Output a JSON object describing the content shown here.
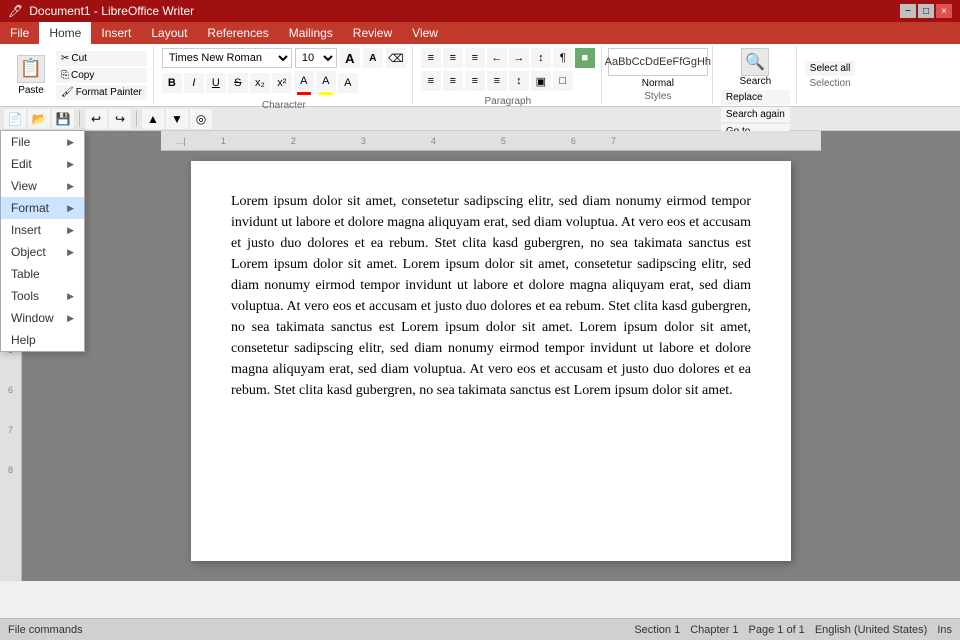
{
  "titleBar": {
    "appName": "Writer",
    "docName": "Document1 - LibreOffice Writer",
    "controls": [
      "−",
      "□",
      "×"
    ]
  },
  "menuBar": {
    "items": [
      "File",
      "Home",
      "Insert",
      "Layout",
      "References",
      "Mailings",
      "Review",
      "View"
    ]
  },
  "ribbon": {
    "activeTab": "Home",
    "tabs": [
      "File",
      "Home",
      "Insert",
      "Layout",
      "References",
      "Mailings",
      "Review",
      "View"
    ]
  },
  "clipboard": {
    "paste": "Paste",
    "cut": "✂ Cut",
    "copy": "⎘ Copy",
    "formatPainter": "Format Painter"
  },
  "font": {
    "name": "Times New Roman",
    "size": "10",
    "bold": "B",
    "italic": "I",
    "underline": "U",
    "strikethrough": "S",
    "superscript": "x²",
    "subscript": "x₂",
    "fontColor": "A",
    "highlight": "A",
    "clearFormat": "⌫",
    "increaseSize": "A",
    "decreaseSize": "A"
  },
  "paragraph": {
    "bullets": "≡",
    "numbering": "≡",
    "multilevel": "≡",
    "increaseIndent": "→",
    "decreaseIndent": "←",
    "sortAZ": "↕",
    "showHide": "¶",
    "alignLeft": "≡",
    "alignCenter": "≡",
    "alignRight": "≡",
    "justify": "≡",
    "lineSpacing": "↕",
    "shading": "■",
    "borders": "□"
  },
  "styles": {
    "previewText": "AaBbCcDdEeFfGgHh",
    "styleName": "Normal"
  },
  "search": {
    "buttonLabel": "Search",
    "replaceLabel": "Replace",
    "searchAgainLabel": "Search again",
    "gotoLabel": "Go to"
  },
  "selection": {
    "selectAllLabel": "Select all"
  },
  "toolbar": {
    "buttons": [
      "↩",
      "↪",
      "✓",
      "□",
      "↓",
      "↑",
      "▲",
      "▼"
    ]
  },
  "dropdown": {
    "items": [
      {
        "label": "File",
        "hasArrow": true
      },
      {
        "label": "Edit",
        "hasArrow": true
      },
      {
        "label": "View",
        "hasArrow": true
      },
      {
        "label": "Format",
        "hasArrow": true
      },
      {
        "label": "Insert",
        "hasArrow": true
      },
      {
        "label": "Object",
        "hasArrow": true
      },
      {
        "label": "Table",
        "hasArrow": false
      },
      {
        "label": "Tools",
        "hasArrow": true
      },
      {
        "label": "Window",
        "hasArrow": true
      },
      {
        "label": "Help",
        "hasArrow": false
      }
    ]
  },
  "document": {
    "content": "Lorem ipsum dolor sit amet, consetetur sadipscing elitr, sed diam nonumy eirmod tempor invidunt ut labore et dolore magna aliquyam erat, sed diam voluptua. At vero eos et accusam et justo duo dolores et ea rebum. Stet clita kasd gubergren, no sea takimata sanctus est Lorem ipsum dolor sit amet. Lorem ipsum dolor sit amet, consetetur sadipscing elitr, sed diam nonumy eirmod tempor invidunt ut labore et dolore magna aliquyam erat, sed diam voluptua. At vero eos et accusam et justo duo dolores et ea rebum. Stet clita kasd gubergren, no sea takimata sanctus est Lorem ipsum dolor sit amet. Lorem ipsum dolor sit amet, consetetur sadipscing elitr, sed diam nonumy eirmod tempor invidunt ut labore et dolore magna aliquyam erat, sed diam voluptua. At vero eos et accusam et justo duo dolores et ea rebum. Stet clita kasd gubergren, no sea takimata sanctus est Lorem ipsum dolor sit amet."
  },
  "statusBar": {
    "section": "Section 1",
    "chapter": "Chapter 1",
    "page": "Page 1 of 1",
    "language": "English (United States)",
    "insertMode": "Ins",
    "fileCommands": "File commands"
  },
  "ruler": {
    "numbers": [
      "1",
      "2",
      "3",
      "4",
      "5",
      "6",
      "7",
      "8"
    ]
  }
}
